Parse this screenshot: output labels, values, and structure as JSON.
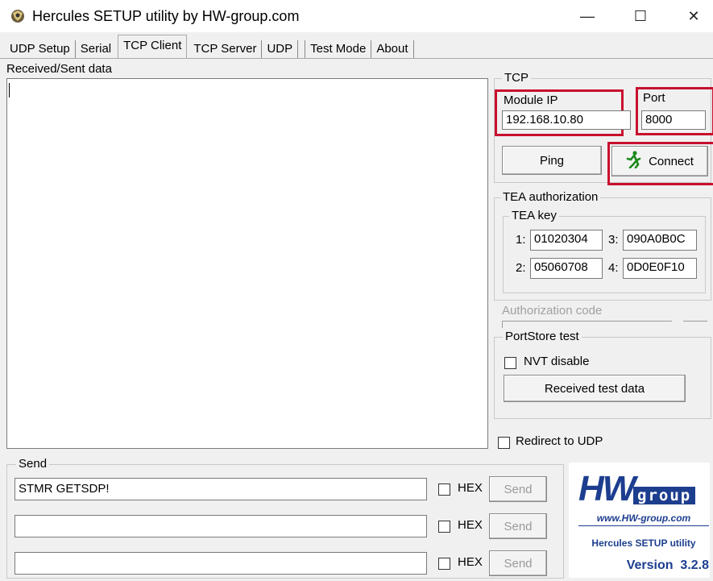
{
  "window": {
    "title": "Hercules SETUP utility by HW-group.com",
    "minimize": "—",
    "maximize": "☐",
    "close": "✕"
  },
  "tabs": [
    "UDP Setup",
    "Serial",
    "TCP Client",
    "TCP Server",
    "UDP",
    "Test Mode",
    "About"
  ],
  "active_tab": "TCP Client",
  "received": {
    "label": "Received/Sent data",
    "content": ""
  },
  "tcp": {
    "group_label": "TCP",
    "module_ip_label": "Module IP",
    "module_ip_value": "192.168.10.80",
    "port_label": "Port",
    "port_value": "8000",
    "ping_label": "Ping",
    "connect_label": "Connect"
  },
  "tea": {
    "group_label": "TEA authorization",
    "key_label": "TEA key",
    "k1_label": "1:",
    "k1_value": "01020304",
    "k2_label": "2:",
    "k2_value": "05060708",
    "k3_label": "3:",
    "k3_value": "090A0B0C",
    "k4_label": "4:",
    "k4_value": "0D0E0F10",
    "auth_code_label": "Authorization code"
  },
  "portstore": {
    "group_label": "PortStore test",
    "nvt_label": "NVT disable",
    "received_test_label": "Received test data"
  },
  "redirect_label": "Redirect to UDP",
  "send": {
    "group_label": "Send",
    "rows": [
      {
        "value": "STMR GETSDP!",
        "hex_label": "HEX",
        "send_label": "Send"
      },
      {
        "value": "",
        "hex_label": "HEX",
        "send_label": "Send"
      },
      {
        "value": "",
        "hex_label": "HEX",
        "send_label": "Send"
      }
    ]
  },
  "logo": {
    "brand": "HW",
    "group": "group",
    "url": "www.HW-group.com",
    "product": "Hercules SETUP utility",
    "version": "Version  3.2.8"
  },
  "colors": {
    "highlight": "#c8102e",
    "logo_blue": "#1d3e8f"
  }
}
